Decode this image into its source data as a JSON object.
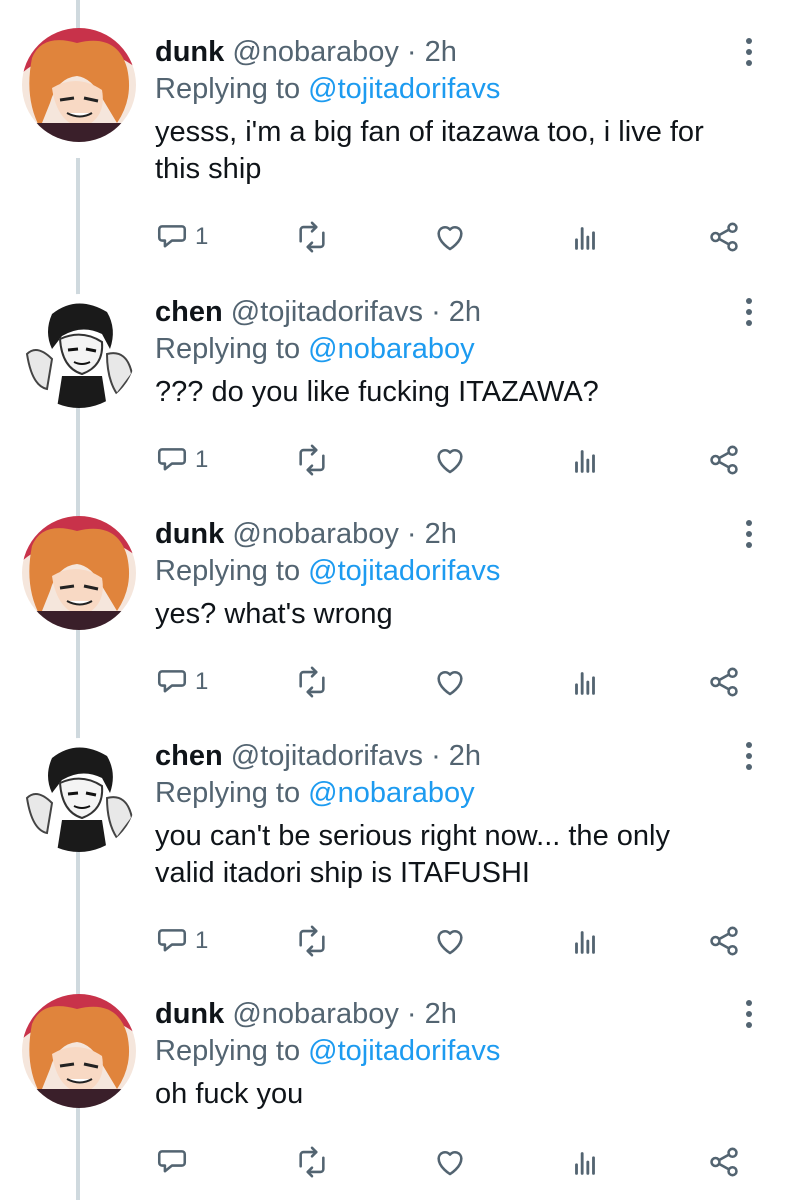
{
  "tweets": [
    {
      "name": "dunk",
      "handle": "@nobaraboy",
      "dot": "·",
      "time": "2h",
      "replying_prefix": "Replying to",
      "replying_to": "@tojitadorifavs",
      "text": "yesss, i'm a big fan of itazawa too, i live for this ship",
      "reply_count": "1",
      "avatar": "orange-hair-avatar"
    },
    {
      "name": "chen",
      "handle": "@tojitadorifavs",
      "dot": "·",
      "time": "2h",
      "replying_prefix": "Replying to",
      "replying_to": "@nobaraboy",
      "text": "??? do you like fucking ITAZAWA?",
      "reply_count": "1",
      "avatar": "black-hair-avatar"
    },
    {
      "name": "dunk",
      "handle": "@nobaraboy",
      "dot": "·",
      "time": "2h",
      "replying_prefix": "Replying to",
      "replying_to": "@tojitadorifavs",
      "text": "yes? what's wrong",
      "reply_count": "1",
      "avatar": "orange-hair-avatar"
    },
    {
      "name": "chen",
      "handle": "@tojitadorifavs",
      "dot": "·",
      "time": "2h",
      "replying_prefix": "Replying to",
      "replying_to": "@nobaraboy",
      "text": "you can't be serious right now... the only valid itadori ship is ITAFUSHI",
      "reply_count": "1",
      "avatar": "black-hair-avatar"
    },
    {
      "name": "dunk",
      "handle": "@nobaraboy",
      "dot": "·",
      "time": "2h",
      "replying_prefix": "Replying to",
      "replying_to": "@tojitadorifavs",
      "text": "oh fuck you",
      "reply_count": "",
      "avatar": "orange-hair-avatar"
    }
  ],
  "colors": {
    "text": "#0f1419",
    "secondary": "#536471",
    "mention": "#1d9bf0",
    "thread_line": "#cfd9de"
  }
}
